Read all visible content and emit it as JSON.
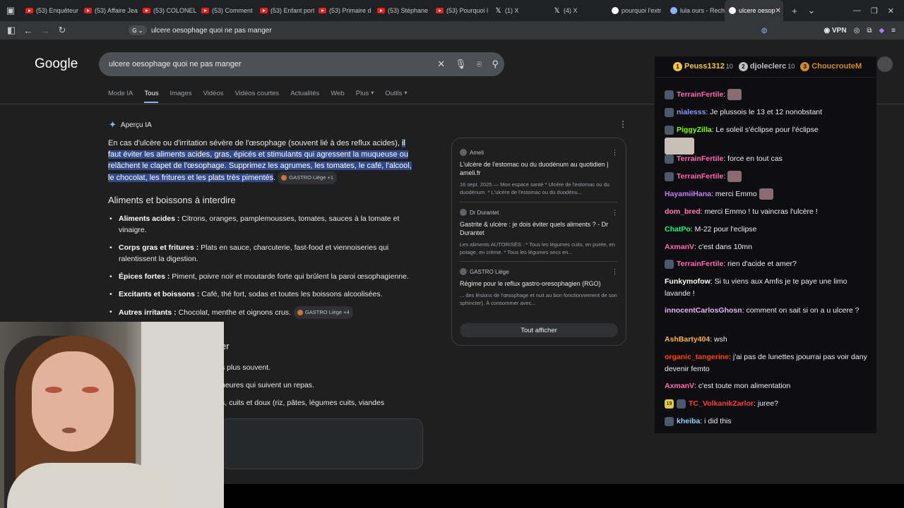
{
  "browser": {
    "tabs": [
      {
        "label": "(53) Enquêteur",
        "icon": "youtube-icon"
      },
      {
        "label": "(53) Affaire Jea",
        "icon": "youtube-icon"
      },
      {
        "label": "(53) COLONEL",
        "icon": "youtube-icon"
      },
      {
        "label": "(53) Comment",
        "icon": "youtube-icon"
      },
      {
        "label": "(53) Enfant port",
        "icon": "youtube-icon"
      },
      {
        "label": "(53) Primaire d",
        "icon": "youtube-icon"
      },
      {
        "label": "(53) Stéphane",
        "icon": "youtube-icon"
      },
      {
        "label": "(53) Pourquoi l",
        "icon": "youtube-icon"
      },
      {
        "label": "(1) X",
        "icon": "x-icon"
      },
      {
        "label": "(4) X",
        "icon": "x-icon"
      },
      {
        "label": "pourquoi l'extr",
        "icon": "google-icon"
      },
      {
        "label": "lula ours - Rech",
        "icon": "search-icon"
      },
      {
        "label": "ulcere oesop",
        "icon": "google-icon",
        "active": true
      }
    ],
    "url": "ulcere oesophage quoi ne pas manger",
    "vpn": "VPN"
  },
  "google": {
    "logo": "Google",
    "query": "ulcere oesophage quoi ne pas manger",
    "nav": [
      "Mode IA",
      "Tous",
      "Images",
      "Vidéos",
      "Vidéos courtes",
      "Actualités",
      "Web",
      "Plus",
      "Outils"
    ],
    "aio_title": "Aperçu IA",
    "intro_plain": "En cas d'ulcère ou d'irritation sévère de l'œsophage (souvent lié à des reflux acides), ",
    "intro_hl": "il faut éviter les aliments acides, gras, épicés et stimulants qui agressent la muqueuse ou relâchent le clapet de l'œsophage. Supprimez les agrumes, les tomates, le café, l'alcool, le chocolat, les fritures et les plats très pimentés",
    "intro_end": ".",
    "intro_chip": "GASTRO Liège +1",
    "heading": "Aliments et boissons à interdire",
    "bullets": [
      {
        "bold": "Aliments acides :",
        "text": " Citrons, oranges, pamplemousses, tomates, sauces à la tomate et vinaigre."
      },
      {
        "bold": "Corps gras et fritures :",
        "text": " Plats en sauce, charcuterie, fast-food et viennoiseries qui ralentissent la digestion."
      },
      {
        "bold": "Épices fortes :",
        "text": " Piment, poivre noir et moutarde forte qui brûlent la paroi œsophagienne."
      },
      {
        "bold": "Excitants et boissons :",
        "text": " Café, thé fort, sodas et toutes les boissons alcoolisées."
      },
      {
        "bold": "Autres irritants :",
        "text": " Chocolat, menthe et oignons crus."
      }
    ],
    "bullet_chip": "GASTRO Liège +4",
    "heading2": "er",
    "list2": [
      "s plus souvent.",
      "heures qui suivent un repas.",
      "s, cuits et doux (riz, pâtes, légumes cuits, viandes"
    ],
    "sources": [
      {
        "site": "Ameli",
        "title": "L'ulcère de l'estomac ou du duodénum au quotidien | ameli.fr",
        "snippet": "16 sept. 2025 — Mon espace santé * Ulcère de l'estomac ou du duodénum. * L'ulcère de l'estomac ou du duodénu..."
      },
      {
        "site": "Dr Durantet",
        "title": "Gastrite & ulcère : je dois éviter quels aliments ? - Dr Durantet",
        "snippet": "Les aliments AUTORISÉS : * Tous les légumes cuits, en purée, en potage, en crème. * Tous les légumes secs en..."
      },
      {
        "site": "GASTRO Liège",
        "title": "Régime pour le reflux gastro-oresophagien (RGO)",
        "snippet": "... des lésions de l'œsophage et nuit au bon fonctionnement de son sphincter). À consommer avec..."
      }
    ],
    "show_all": "Tout afficher"
  },
  "chat": {
    "top": [
      {
        "rank": "1",
        "name": "Peuss1312",
        "count": "10",
        "color": "#f5c542"
      },
      {
        "rank": "2",
        "name": "djoleclerc",
        "count": "10",
        "color": "#c0c0c0"
      },
      {
        "rank": "3",
        "name": "ChoucrouteM",
        "count": "",
        "color": "#d08a2e"
      }
    ],
    "messages": [
      {
        "user": "TerrainFertile",
        "color": "#ff69b4",
        "text": ":",
        "badge": true,
        "emote": true
      },
      {
        "user": "nialesss",
        "color": "#8a9cff",
        "text": ": Je plussois le 13 et 12 nonobstant",
        "badge": true
      },
      {
        "user": "PiggyZilla",
        "color": "#7fff00",
        "text": ": Le soleil s'éclipse pour l'éclipse",
        "badge": true,
        "image": true
      },
      {
        "user": "TerrainFertile",
        "color": "#ff69b4",
        "text": ": force en tout cas",
        "badge": true
      },
      {
        "user": "TerrainFertile",
        "color": "#ff69b4",
        "text": ":",
        "badge": true,
        "emote": true
      },
      {
        "user": "HayamiiHana",
        "color": "#c77dff",
        "text": ": merci Emmo",
        "emote": true
      },
      {
        "user": "dom_bred",
        "color": "#ff7eb3",
        "text": ": merci Emmo ! tu vaincras l'ulcère !"
      },
      {
        "user": "ChatPo",
        "color": "#00ff7f",
        "text": ": M-22 pour l'eclipse"
      },
      {
        "user": "AxmanV",
        "color": "#ff69b4",
        "text": ": c'est dans 10mn"
      },
      {
        "user": "TerrainFertile",
        "color": "#ff69b4",
        "text": ": rien d'acide et amer?",
        "badge": true
      },
      {
        "user": "Funkymofow",
        "color": "#ffffff",
        "text": ": Si tu viens aux Amfis je te paye une limo lavande !"
      },
      {
        "user": "innocentCarlosGhosn",
        "color": "#e7b3ff",
        "text": ": comment on sait si on a u ulcere ?"
      },
      {
        "user": "AshBarty404",
        "color": "#ffb347",
        "text": ": wsh"
      },
      {
        "user": "organic_tangerine",
        "color": "#ff4500",
        "text": ": j'ai pas de lunettes jpourrai pas voir dany devenir femto"
      },
      {
        "user": "AxmanV",
        "color": "#ff69b4",
        "text": ": c'est toute mon alimentation"
      },
      {
        "user": "TC_VolkanikZarlor",
        "color": "#ff3b3b",
        "text": ": juree?",
        "badge": true,
        "sub": "19"
      },
      {
        "user": "kheiba",
        "color": "#8fd3ff",
        "text": ": i did this",
        "badge": true
      }
    ]
  }
}
